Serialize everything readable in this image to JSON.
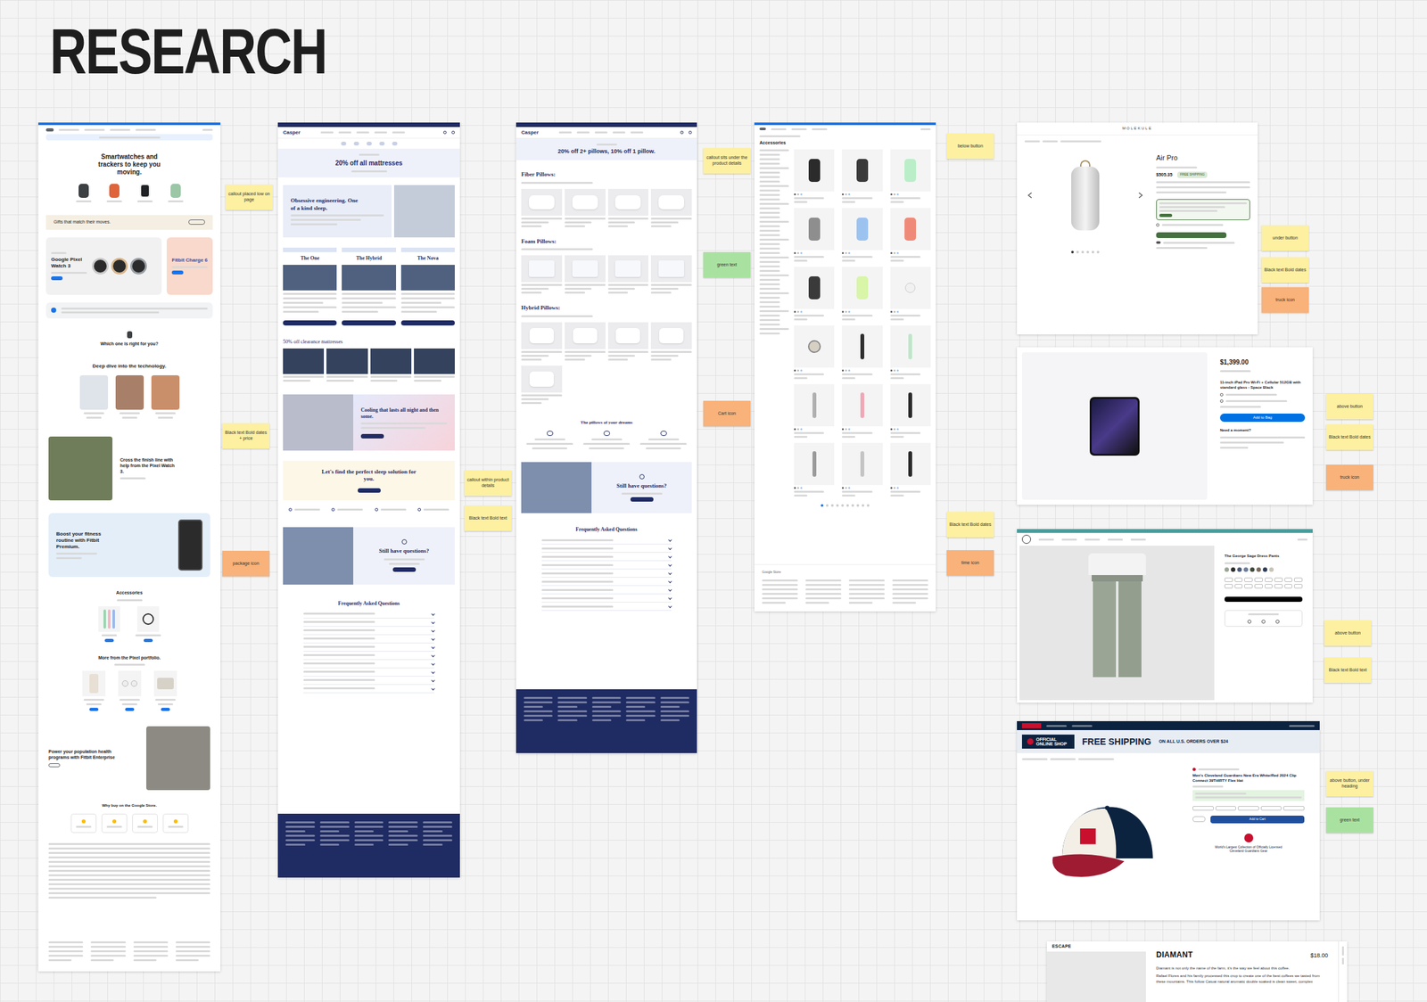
{
  "board": {
    "title": "RESEARCH"
  },
  "notes": [
    {
      "text": "callout placed low on page",
      "color": "#fdf0a0"
    },
    {
      "text": "Black text Bold dates + price",
      "color": "#fdf0a0"
    },
    {
      "text": "package icon",
      "color": "#f8b27a"
    },
    {
      "text": "callout within product details",
      "color": "#fdf0a0"
    },
    {
      "text": "Black text Bold text",
      "color": "#fdf0a0"
    },
    {
      "text": "callout sits under the product details",
      "color": "#fdf0a0"
    },
    {
      "text": "green text",
      "color": "#a9e2a0"
    },
    {
      "text": "Cart icon",
      "color": "#f8b27a"
    },
    {
      "text": "below button",
      "color": "#fdf0a0"
    },
    {
      "text": "Black text Bold dates",
      "color": "#fdf0a0"
    },
    {
      "text": "time icon",
      "color": "#f8b27a"
    },
    {
      "text": "under button",
      "color": "#fdf0a0"
    },
    {
      "text": "Black text Bold dates",
      "color": "#fdf0a0"
    },
    {
      "text": "truck icon",
      "color": "#f8b27a"
    },
    {
      "text": "above button",
      "color": "#fdf0a0"
    },
    {
      "text": "Black text Bold dates",
      "color": "#fdf0a0"
    },
    {
      "text": "truck icon",
      "color": "#f8b27a"
    },
    {
      "text": "above button",
      "color": "#fdf0a0"
    },
    {
      "text": "Black text Bold text",
      "color": "#fdf0a0"
    },
    {
      "text": "above button, under heading",
      "color": "#fdf0a0"
    },
    {
      "text": "green text",
      "color": "#a9e2a0"
    }
  ],
  "shots": {
    "google_store": {
      "hero": "Smartwatches and trackers to keep you moving.",
      "callout": "Gifts that match their moves.",
      "card_a": "Google Pixel Watch 3",
      "card_b": "Fitbit Charge 6",
      "which": "Which one is right for you?",
      "deep_dive": "Deep dive into the technology.",
      "finish": "Cross the finish line with help from the Pixel Watch 3.",
      "premium": "Boost your fitness routine with Fitbit Premium.",
      "accessories": "Accessories",
      "portfolio": "More from the Pixel portfolio.",
      "enterprise": "Power your population health programs with Fitbit Enterprise",
      "why_buy": "Why buy on the Google Store."
    },
    "casper_mattresses": {
      "logo": "Casper",
      "promo": "20% off all mattresses",
      "engineering": "Obsessive engineering. One of a kind sleep.",
      "products": [
        "The One",
        "The Hybrid",
        "The Nova"
      ],
      "clearance": "50% off clearance mattresses",
      "cooling": "Cooling that lasts all night and then some.",
      "finder": "Let's find the perfect sleep solution for you.",
      "questions": "Still have questions?",
      "faq": "Frequently Asked Questions"
    },
    "casper_pillows": {
      "logo": "Casper",
      "promo": "20% off 2+ pillows, 10% off 1 pillow.",
      "groups": [
        "Fiber Pillows:",
        "Foam Pillows:",
        "Hybrid Pillows:"
      ],
      "dreams": "The pillows of your dreams",
      "questions": "Still have questions?",
      "faq": "Frequently Asked Questions"
    },
    "google_accessories": {
      "title": "Accessories",
      "footer_logo": "Google Store"
    },
    "molekule": {
      "logo": "MOLEKULE",
      "product": "Air Pro",
      "price": "$505.35",
      "badge": "FREE SHIPPING"
    },
    "apple_ipad": {
      "price": "$1,399.00",
      "title": "11-inch iPad Pro Wi-Fi + Cellular 512GB with standard glass - Space Black",
      "button": "Add to Bag",
      "help": "Need a moment?"
    },
    "dress_pants": {
      "title": "The George Sage Dress Pants"
    },
    "guardians_hat": {
      "shop": "OFFICIAL ONLINE SHOP",
      "shipping": "FREE SHIPPING",
      "shipping_detail": "ON ALL U.S. ORDERS OVER $24",
      "title": "Men's Cleveland Guardians New Era White/Red 2024 Clip Connect 39THIRTY Flex Hat",
      "button": "Add to Cart",
      "tagline": "World's Largest Collection of Officially Licensed Cleveland Guardians Gear"
    },
    "escape_coffee": {
      "logo": "ESCAPE",
      "name": "DIAMANT",
      "price": "$18.00",
      "intro": "Diamant is not only the name of the farm, it's the way we feel about this coffee.",
      "body": "Rafael Flores and his family processed this crop to create one of the best coffees we tasted from these mountains. This follow Catuai natural aromatic double soaked is clean sweet, complex"
    }
  }
}
